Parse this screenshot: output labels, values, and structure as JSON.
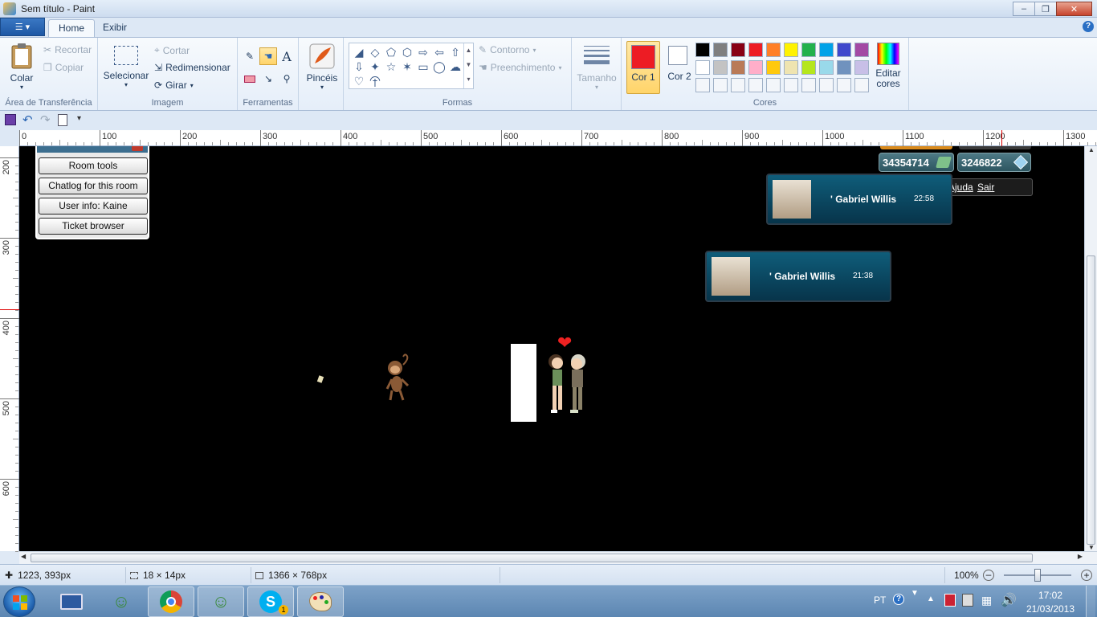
{
  "window": {
    "title": "Sem título - Paint",
    "controls": [
      "minimize",
      "maximize",
      "close"
    ]
  },
  "tabs": [
    {
      "label": "Home",
      "active": true
    },
    {
      "label": "Exibir",
      "active": false
    }
  ],
  "ribbon": {
    "clipboard": {
      "paste": "Colar",
      "cut": "Recortar",
      "copy": "Copiar",
      "label": "Área de Transferência"
    },
    "image": {
      "select": "Selecionar",
      "crop": "Cortar",
      "resize": "Redimensionar",
      "rotate": "Girar",
      "label": "Imagem"
    },
    "tools": {
      "label": "Ferramentas"
    },
    "brushes": {
      "label": "Pincéis"
    },
    "shapes": {
      "outline": "Contorno",
      "fill": "Preenchimento",
      "label": "Formas"
    },
    "size": {
      "label": "Tamanho"
    },
    "colors": {
      "color1": "Cor 1",
      "color2": "Cor 2",
      "color1_value": "#ed1c24",
      "color2_value": "#ffffff",
      "edit": "Editar cores",
      "label": "Cores",
      "palette_row1": [
        "#000000",
        "#7f7f7f",
        "#880015",
        "#ed1c24",
        "#ff7f27",
        "#fff200",
        "#22b14c",
        "#00a2e8",
        "#3f48cc",
        "#a349a4"
      ],
      "palette_row2": [
        "#ffffff",
        "#c3c3c3",
        "#b97a57",
        "#ffaec9",
        "#ffc90e",
        "#efe4b0",
        "#b5e61d",
        "#99d9ea",
        "#7092be",
        "#c8bfe7"
      ]
    }
  },
  "ruler": {
    "h_ticks": [
      "0",
      "100",
      "200",
      "300",
      "400",
      "500",
      "600",
      "700",
      "800",
      "900",
      "1000",
      "1100",
      "1200",
      "1300"
    ],
    "v_ticks": [
      "200",
      "300",
      "400",
      "500",
      "600"
    ]
  },
  "canvas": {
    "mod_tools": [
      "Room tools",
      "Chatlog for this room",
      "User info: Kaine",
      "Ticket browser"
    ],
    "credits": "34354714",
    "diamonds": "3246822",
    "help_links": {
      "help": "Ajuda",
      "exit": "Sair"
    },
    "notifications": [
      {
        "name": "' Gabriel Willis",
        "time": "22:58"
      },
      {
        "name": "' Gabriel Willis",
        "time": "21:38"
      }
    ]
  },
  "status": {
    "cursor": "1223, 393px",
    "selection": "18 × 14px",
    "canvas_size": "1366 × 768px",
    "zoom": "100%"
  },
  "taskbar": {
    "apps": [
      "keyboard",
      "users",
      "chrome",
      "users",
      "skype",
      "paint"
    ],
    "skype_badge": "1",
    "language": "PT",
    "time": "17:02",
    "date": "21/03/2013"
  }
}
